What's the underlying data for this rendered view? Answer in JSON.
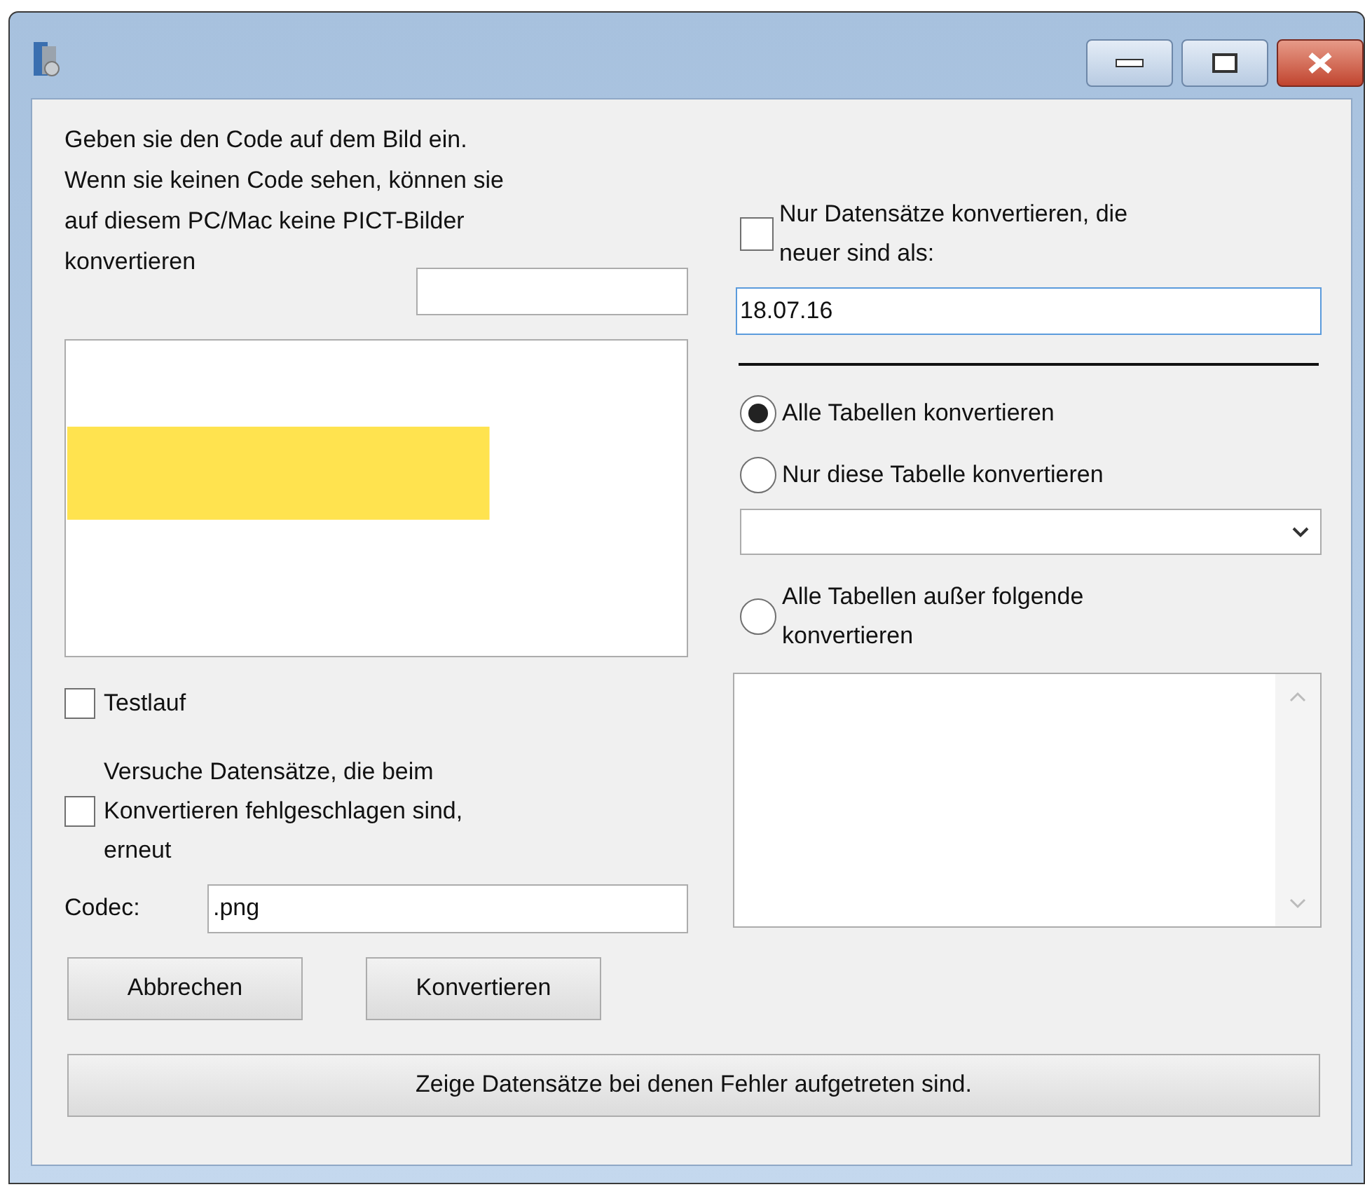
{
  "captcha": {
    "instructions": "Geben sie den Code auf dem Bild ein. Wenn sie keinen Code sehen, können sie auf diesem PC/Mac keine PICT-Bilder konvertieren"
  },
  "options": [
    {
      "label": "Testlauf",
      "checked": false
    },
    {
      "label": "Versuche Datensätze, die beim Konvertieren fehlgeschlagen sind, erneut",
      "checked": false
    }
  ],
  "codec": {
    "label": "Codec:",
    "value": ".png"
  },
  "buttons": [
    "Abbrechen",
    "Konvertieren"
  ],
  "show_errors_button": "Zeige Datensätze bei denen Fehler aufgetreten sind.",
  "date_filter": {
    "label": "Nur Datensätze konvertieren, die neuer sind als:",
    "checked": false,
    "value": "18.07.16"
  },
  "table_mode": [
    {
      "kind": "plain",
      "label": "Alle Tabellen konvertieren",
      "selected": true
    },
    {
      "kind": "dropdown",
      "label": "Nur diese Tabelle konvertieren",
      "selected": false
    },
    {
      "kind": "list",
      "label": "Alle Tabellen außer folgende konvertieren",
      "selected": false
    }
  ]
}
